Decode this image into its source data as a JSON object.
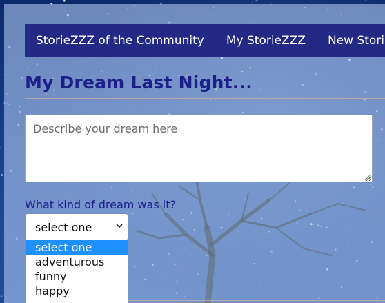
{
  "nav": {
    "items": [
      {
        "label": "StorieZZZ of the Community"
      },
      {
        "label": "My StorieZZZ"
      },
      {
        "label": "New StorieZZZ"
      }
    ]
  },
  "page": {
    "title": "My Dream Last Night..."
  },
  "dream_field": {
    "placeholder": "Describe your dream here",
    "value": ""
  },
  "dream_kind": {
    "label": "What kind of dream was it?",
    "selected": "select one",
    "options": [
      "select one",
      "adventurous",
      "funny",
      "happy"
    ]
  },
  "theme": {
    "nav_bg": "#232a86",
    "title_color": "#1c1f8a",
    "selected_option_bg": "#1e90ff"
  }
}
